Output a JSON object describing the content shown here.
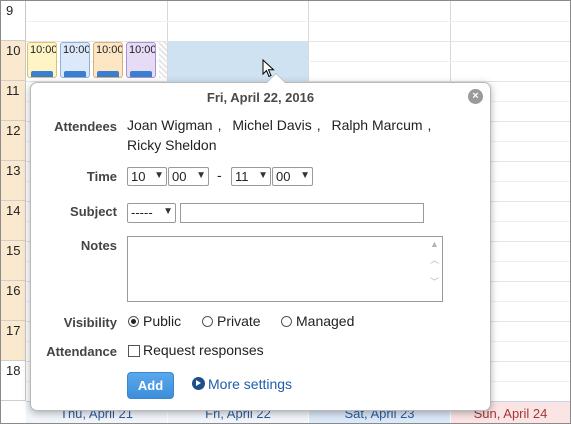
{
  "hours": [
    "9",
    "10",
    "11",
    "12",
    "13",
    "14",
    "15",
    "16",
    "17",
    "18"
  ],
  "events": [
    {
      "time": "10:00",
      "color": "#fff4c6"
    },
    {
      "time": "10:00",
      "color": "#dbe9fb"
    },
    {
      "time": "10:00",
      "color": "#fde6c3"
    },
    {
      "time": "10:00",
      "color": "#e6dcf6"
    }
  ],
  "days": [
    "Thu, April 21",
    "Fri, April 22",
    "Sat, April 23",
    "Sun, April 24"
  ],
  "popup": {
    "title": "Fri, April 22, 2016",
    "close_icon": "×",
    "attendees_label": "Attendees",
    "attendees": [
      "Joan Wigman",
      "Michel Davis",
      "Ralph Marcum",
      "Ricky Sheldon"
    ],
    "time_label": "Time",
    "start_hour": "10",
    "start_minute": "00",
    "time_separator": "-",
    "end_hour": "11",
    "end_minute": "00",
    "subject_label": "Subject",
    "subject_category": "-----",
    "subject_value": "",
    "notes_label": "Notes",
    "notes_value": "",
    "visibility_label": "Visibility",
    "visibility_options": [
      "Public",
      "Private",
      "Managed"
    ],
    "visibility_selected": "Public",
    "attendance_label": "Attendance",
    "request_responses_label": "Request responses",
    "request_responses_checked": false,
    "add_button": "Add",
    "more_settings": "More settings"
  }
}
